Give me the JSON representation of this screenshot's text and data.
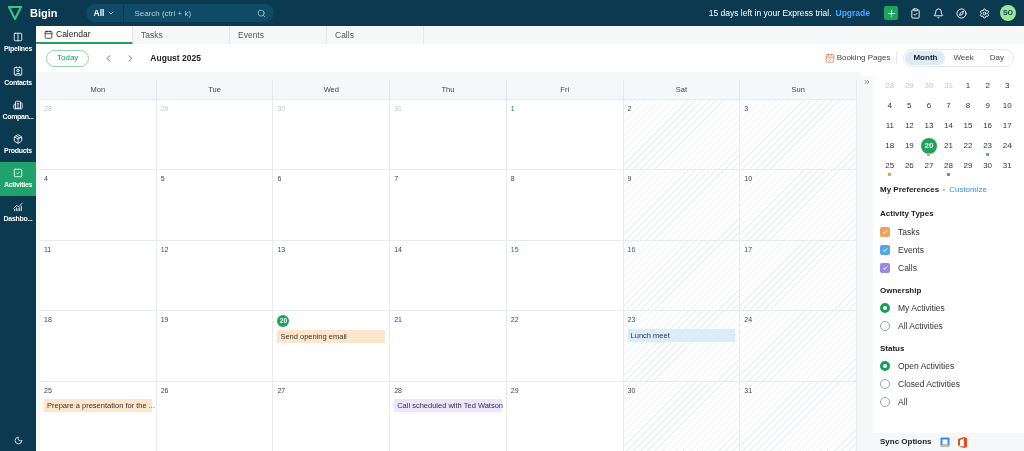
{
  "app": {
    "name": "Bigin"
  },
  "search": {
    "scope": "All",
    "placeholder": "Search (ctrl + k)"
  },
  "trial": {
    "message": "15 days left in your Express trial.",
    "link": "Upgrade"
  },
  "user": {
    "initials": "SO"
  },
  "sidebar": {
    "items": [
      {
        "label": "Pipelines",
        "selected": false
      },
      {
        "label": "Contacts",
        "selected": false
      },
      {
        "label": "Compan...",
        "selected": false
      },
      {
        "label": "Products",
        "selected": false
      },
      {
        "label": "Activities",
        "selected": true
      },
      {
        "label": "Dashbo...",
        "selected": false
      }
    ]
  },
  "tabs": [
    {
      "label": "Calendar",
      "selected": true
    },
    {
      "label": "Tasks",
      "selected": false
    },
    {
      "label": "Events",
      "selected": false
    },
    {
      "label": "Calls",
      "selected": false
    }
  ],
  "toolbar": {
    "today": "Today",
    "period": "August 2025",
    "booking": "Booking Pages",
    "views": [
      {
        "label": "Month",
        "selected": true
      },
      {
        "label": "Week",
        "selected": false
      },
      {
        "label": "Day",
        "selected": false
      }
    ]
  },
  "calendar": {
    "columns": [
      {
        "label": "Mon",
        "weekend": false
      },
      {
        "label": "Tue",
        "weekend": false
      },
      {
        "label": "Wed",
        "weekend": false
      },
      {
        "label": "Thu",
        "weekend": false
      },
      {
        "label": "Fri",
        "weekend": false
      },
      {
        "label": "Sat",
        "weekend": true
      },
      {
        "label": "Sun",
        "weekend": true
      }
    ],
    "weeks": [
      {
        "days": [
          {
            "label": "28",
            "muted": true
          },
          {
            "label": "29",
            "muted": true
          },
          {
            "label": "30",
            "muted": true
          },
          {
            "label": "31",
            "muted": true
          },
          {
            "label": "1",
            "holiday": true
          },
          {
            "label": "2"
          },
          {
            "label": "3"
          }
        ]
      },
      {
        "days": [
          {
            "label": "4"
          },
          {
            "label": "5"
          },
          {
            "label": "6"
          },
          {
            "label": "7"
          },
          {
            "label": "8"
          },
          {
            "label": "9"
          },
          {
            "label": "10"
          }
        ]
      },
      {
        "days": [
          {
            "label": "11"
          },
          {
            "label": "12"
          },
          {
            "label": "13"
          },
          {
            "label": "14"
          },
          {
            "label": "15",
            "holiday": true
          },
          {
            "label": "16",
            "holiday": true
          },
          {
            "label": "17"
          }
        ]
      },
      {
        "days": [
          {
            "label": "18"
          },
          {
            "label": "19"
          },
          {
            "label": "20",
            "today": true,
            "events": [
              {
                "title": "Send opening email",
                "color": "#fde6cc"
              }
            ]
          },
          {
            "label": "21"
          },
          {
            "label": "22"
          },
          {
            "label": "23",
            "events": [
              {
                "title": "Lunch meet",
                "color": "#d9ecfb"
              }
            ]
          },
          {
            "label": "24"
          }
        ]
      },
      {
        "days": [
          {
            "label": "25",
            "events": [
              {
                "title": "Prepare a presentation for the ...",
                "color": "#fde6cc"
              }
            ]
          },
          {
            "label": "26"
          },
          {
            "label": "27"
          },
          {
            "label": "28",
            "events": [
              {
                "title": "Call scheduled with Ted Watson",
                "color": "#ebe6fb"
              }
            ]
          },
          {
            "label": "29"
          },
          {
            "label": "30"
          },
          {
            "label": "31"
          }
        ]
      }
    ]
  },
  "mini_calendar": {
    "weeks": [
      [
        {
          "label": "28",
          "muted": true
        },
        {
          "label": "29",
          "muted": true
        },
        {
          "label": "30",
          "muted": true
        },
        {
          "label": "31",
          "muted": true
        },
        {
          "label": "1"
        },
        {
          "label": "2"
        },
        {
          "label": "3"
        }
      ],
      [
        {
          "label": "4"
        },
        {
          "label": "5"
        },
        {
          "label": "6"
        },
        {
          "label": "7"
        },
        {
          "label": "8"
        },
        {
          "label": "9"
        },
        {
          "label": "10"
        }
      ],
      [
        {
          "label": "11"
        },
        {
          "label": "12"
        },
        {
          "label": "13"
        },
        {
          "label": "14"
        },
        {
          "label": "15"
        },
        {
          "label": "16"
        },
        {
          "label": "17"
        }
      ],
      [
        {
          "label": "18"
        },
        {
          "label": "19"
        },
        {
          "label": "20",
          "selected": true,
          "color": "#f0a050"
        },
        {
          "label": "21"
        },
        {
          "label": "22"
        },
        {
          "label": "23",
          "color": "#5aa0e6"
        },
        {
          "label": "24"
        }
      ],
      [
        {
          "label": "25",
          "color": "#f0a050"
        },
        {
          "label": "26"
        },
        {
          "label": "27"
        },
        {
          "label": "28",
          "color": "#8a7ae6"
        },
        {
          "label": "29"
        },
        {
          "label": "30"
        },
        {
          "label": "31"
        }
      ]
    ]
  },
  "preferences": {
    "title": "My Preferences",
    "link": "Customize",
    "activity_types": {
      "title": "Activity Types",
      "items": [
        {
          "label": "Tasks",
          "checked": true,
          "color": "#f0a35a"
        },
        {
          "label": "Events",
          "checked": true,
          "color": "#5aa7e6"
        },
        {
          "label": "Calls",
          "checked": true,
          "color": "#9b86e8"
        }
      ]
    },
    "ownership": {
      "title": "Ownership",
      "options": [
        {
          "label": "My Activities",
          "selected": true
        },
        {
          "label": "All Activities",
          "selected": false
        }
      ]
    },
    "status": {
      "title": "Status",
      "options": [
        {
          "label": "Open Activities",
          "selected": true
        },
        {
          "label": "Closed Activities",
          "selected": false
        },
        {
          "label": "All",
          "selected": false
        }
      ]
    }
  },
  "sync": {
    "title": "Sync Options"
  }
}
